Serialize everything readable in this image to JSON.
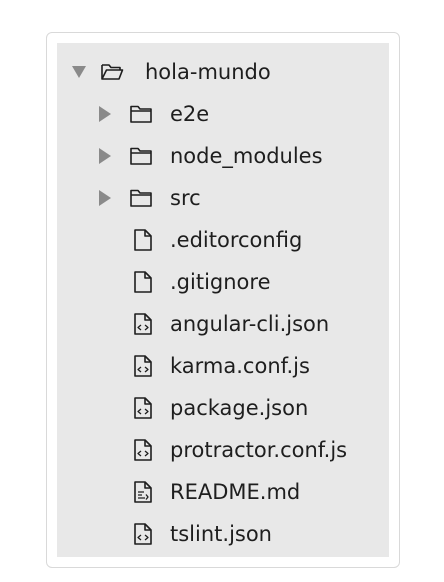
{
  "tree": {
    "root": {
      "label": "hola-mundo",
      "icon": "folder-open-icon"
    },
    "folders": [
      {
        "label": "e2e",
        "icon": "folder-icon"
      },
      {
        "label": "node_modules",
        "icon": "folder-icon"
      },
      {
        "label": "src",
        "icon": "folder-icon"
      }
    ],
    "files": [
      {
        "label": ".editorconfig",
        "icon": "file-icon"
      },
      {
        "label": ".gitignore",
        "icon": "file-icon"
      },
      {
        "label": "angular-cli.json",
        "icon": "code-file-icon"
      },
      {
        "label": "karma.conf.js",
        "icon": "code-file-icon"
      },
      {
        "label": "package.json",
        "icon": "code-file-icon"
      },
      {
        "label": "protractor.conf.js",
        "icon": "code-file-icon"
      },
      {
        "label": "README.md",
        "icon": "markdown-file-icon"
      },
      {
        "label": "tslint.json",
        "icon": "code-file-icon"
      }
    ]
  },
  "colors": {
    "panel_background": "#e8e8e8",
    "text": "#1e1e1e",
    "arrow": "#8a8a8a"
  }
}
